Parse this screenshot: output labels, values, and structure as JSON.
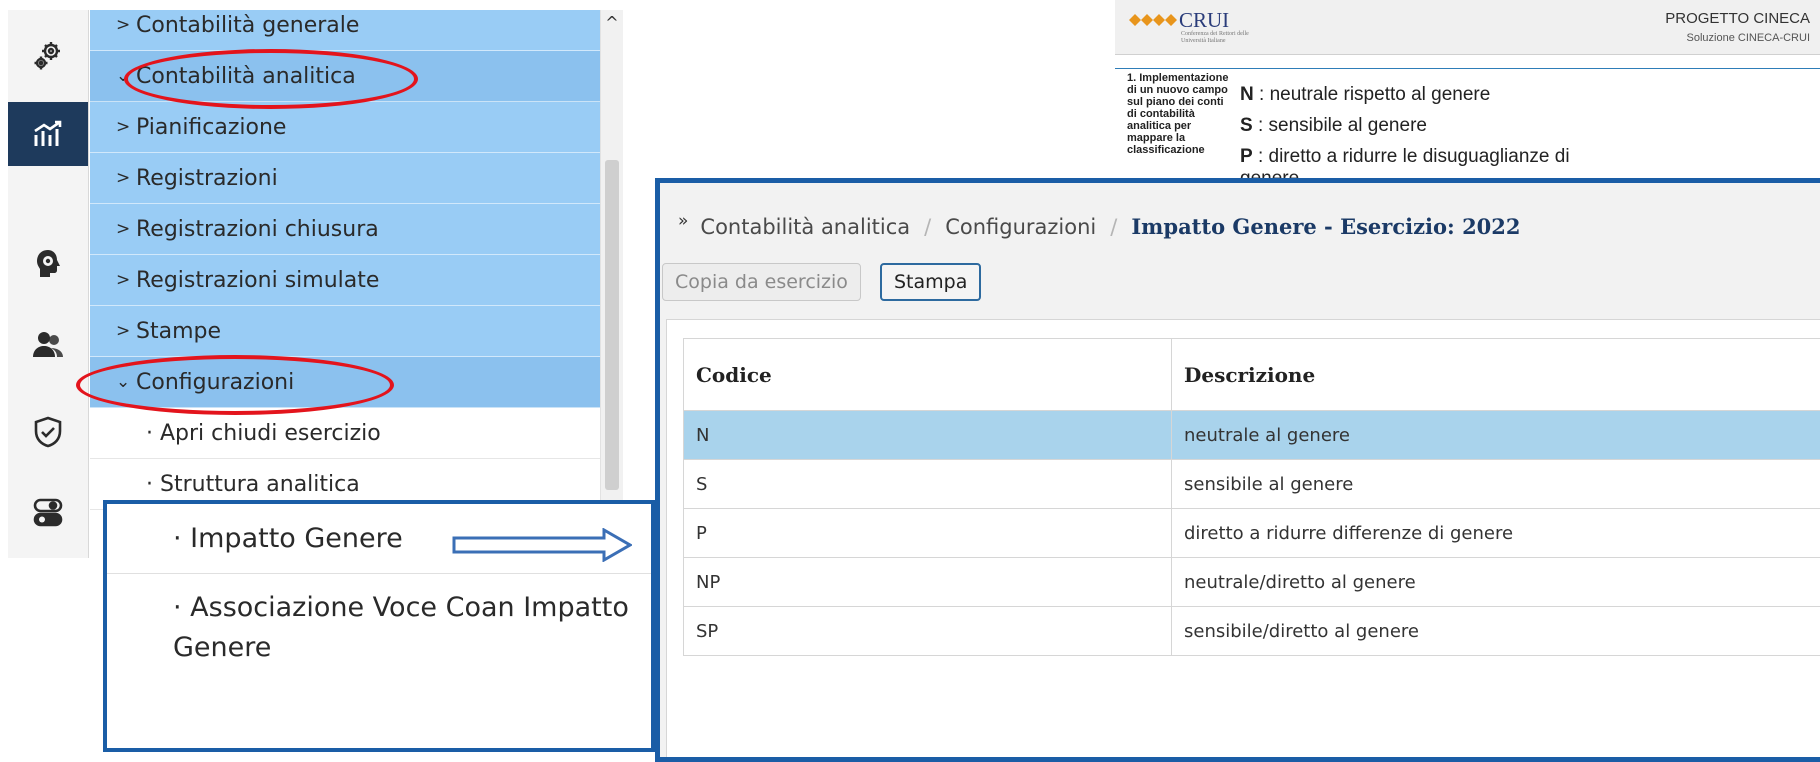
{
  "menu": {
    "items": [
      {
        "label": "Contabilità generale",
        "caret": ">"
      },
      {
        "label": "Contabilità analitica",
        "caret": "⌄"
      },
      {
        "label": "Pianificazione",
        "caret": ">"
      },
      {
        "label": "Registrazioni",
        "caret": ">"
      },
      {
        "label": "Registrazioni chiusura",
        "caret": ">"
      },
      {
        "label": "Registrazioni simulate",
        "caret": ">"
      },
      {
        "label": "Stampe",
        "caret": ">"
      },
      {
        "label": "Configurazioni",
        "caret": "⌄"
      }
    ],
    "subitems": [
      {
        "label": "· Apri chiudi esercizio"
      },
      {
        "label": "· Struttura analitica"
      }
    ]
  },
  "callout": {
    "item1": "· Impatto Genere",
    "item2": "· Associazione Voce Coan Impatto Genere"
  },
  "doc": {
    "brand": "CRUI",
    "brand_sub": "Conferenza dei Rettori delle Università Italiane",
    "progetto": "PROGETTO CINECA",
    "soluzione": "Soluzione CINECA-CRUI",
    "left_text": "1. Implementazione di un nuovo campo sul piano dei conti di contabilità analitica per mappare la classificazione",
    "lines": [
      {
        "code": "N",
        "text": " : neutrale rispetto al genere"
      },
      {
        "code": "S",
        "text": " : sensibile al genere"
      },
      {
        "code": "P",
        "text": " : diretto a ridurre le disuguaglianze di"
      },
      {
        "code": "",
        "text": "genere"
      }
    ]
  },
  "app": {
    "breadcrumb": {
      "item1": "Contabilità analitica",
      "item2": "Configurazioni",
      "current": "Impatto Genere - Esercizio: 2022"
    },
    "buttons": {
      "copy": "Copia da esercizio",
      "print": "Stampa"
    },
    "table": {
      "headers": [
        "Codice",
        "Descrizione"
      ],
      "rows": [
        {
          "code": "N",
          "desc": "neutrale al genere"
        },
        {
          "code": "S",
          "desc": "sensibile al genere"
        },
        {
          "code": "P",
          "desc": "diretto a ridurre differenze di genere"
        },
        {
          "code": "NP",
          "desc": "neutrale/diretto al genere"
        },
        {
          "code": "SP",
          "desc": "sensibile/diretto al genere"
        }
      ],
      "selected_row": 0
    }
  },
  "colors": {
    "menu_bg": "#99ccf5",
    "highlight_ellipse": "#e3141c",
    "callout_border": "#1a5da6",
    "rail_active": "#1e3a5c",
    "selected_row": "#a9d3ec"
  },
  "rail_icons": [
    "gears-icon",
    "chart-growth-icon",
    "brain-gear-icon",
    "users-icon",
    "shield-check-icon",
    "toggle-switches-icon"
  ]
}
